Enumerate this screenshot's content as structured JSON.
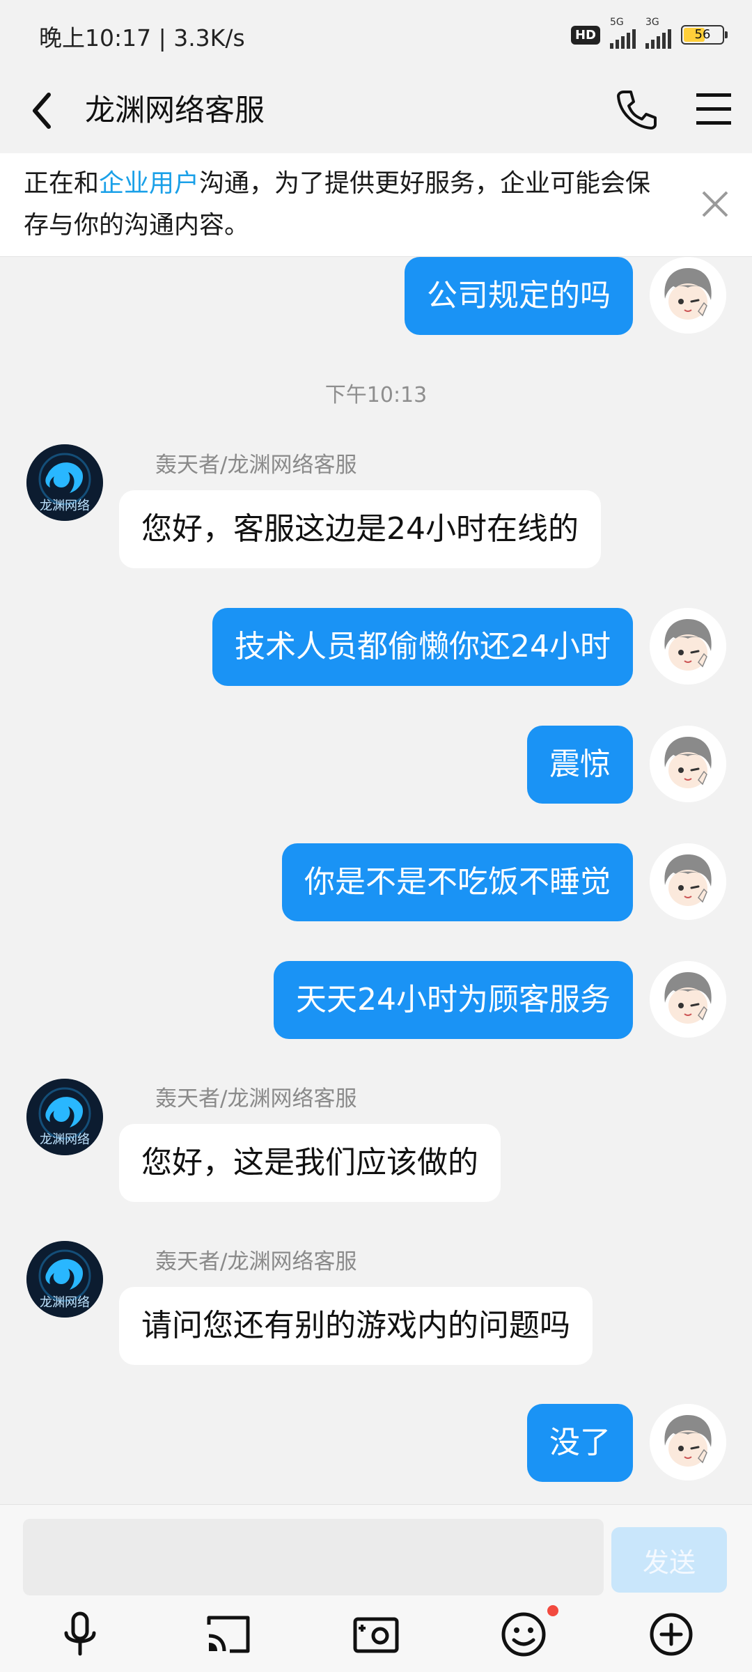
{
  "status_bar": {
    "time_speed": "晚上10:17 | 3.3K/s",
    "hd": "HD",
    "net1": "5G",
    "net2": "3G",
    "battery": "56"
  },
  "header": {
    "title": "龙渊网络客服"
  },
  "notice": {
    "prefix": "正在和",
    "link": "企业用户",
    "suffix": "沟通，为了提供更好服务，企业可能会保存与你的沟通内容。"
  },
  "chat": {
    "timestamp": "下午10:13",
    "sender_name": "轰天者/龙渊网络客服",
    "bot_avatar_text": "龙渊网络",
    "messages": [
      {
        "from": "me",
        "text": "公司规定的吗"
      },
      {
        "from": "bot",
        "text": "您好，客服这边是24小时在线的"
      },
      {
        "from": "me",
        "text": "技术人员都偷懒你还24小时"
      },
      {
        "from": "me",
        "text": "震惊"
      },
      {
        "from": "me",
        "text": "你是不是不吃饭不睡觉"
      },
      {
        "from": "me",
        "text": "天天24小时为顾客服务"
      },
      {
        "from": "bot",
        "text": "您好，这是我们应该做的"
      },
      {
        "from": "bot",
        "text": "请问您还有别的游戏内的问题吗"
      },
      {
        "from": "me",
        "text": "没了"
      }
    ]
  },
  "input": {
    "value": "",
    "send_label": "发送"
  },
  "colors": {
    "accent": "#1a93f5",
    "link": "#1aa0e8",
    "notification_dot": "#f24a3f"
  }
}
